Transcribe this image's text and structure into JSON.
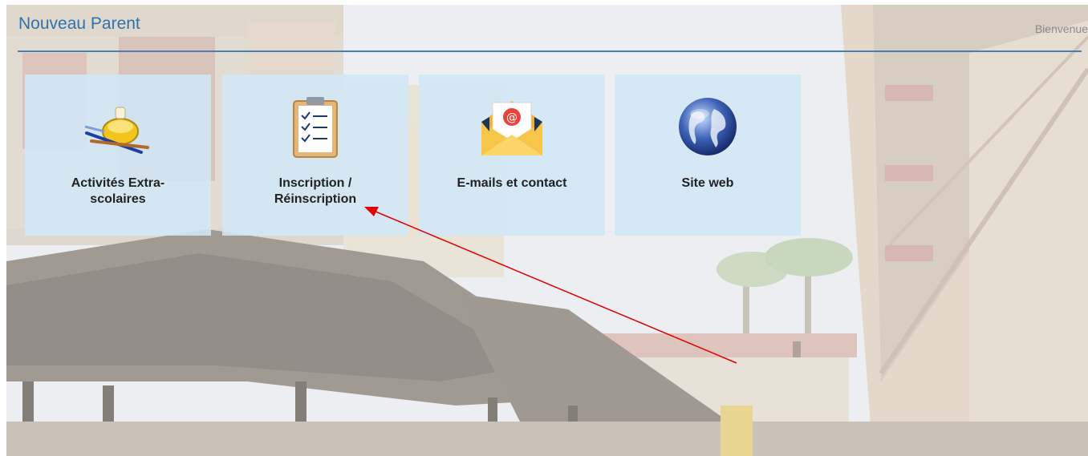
{
  "header": {
    "title": "Nouveau Parent",
    "welcome": "Bienvenue"
  },
  "tiles": [
    {
      "line1": "Activités Extra-",
      "line2": "scolaires",
      "icon": "paint-palette-icon"
    },
    {
      "line1": "Inscription /",
      "line2": "Réinscription",
      "icon": "checklist-clipboard-icon"
    },
    {
      "line1": "E-mails et contact",
      "line2": "",
      "icon": "email-envelope-icon"
    },
    {
      "line1": "Site web",
      "line2": "",
      "icon": "globe-icon"
    }
  ],
  "colors": {
    "title": "#2f73ad",
    "header_line": "#4a7fb3",
    "tile_bg": "#d1e7f6",
    "annotation_arrow": "#e00000"
  }
}
